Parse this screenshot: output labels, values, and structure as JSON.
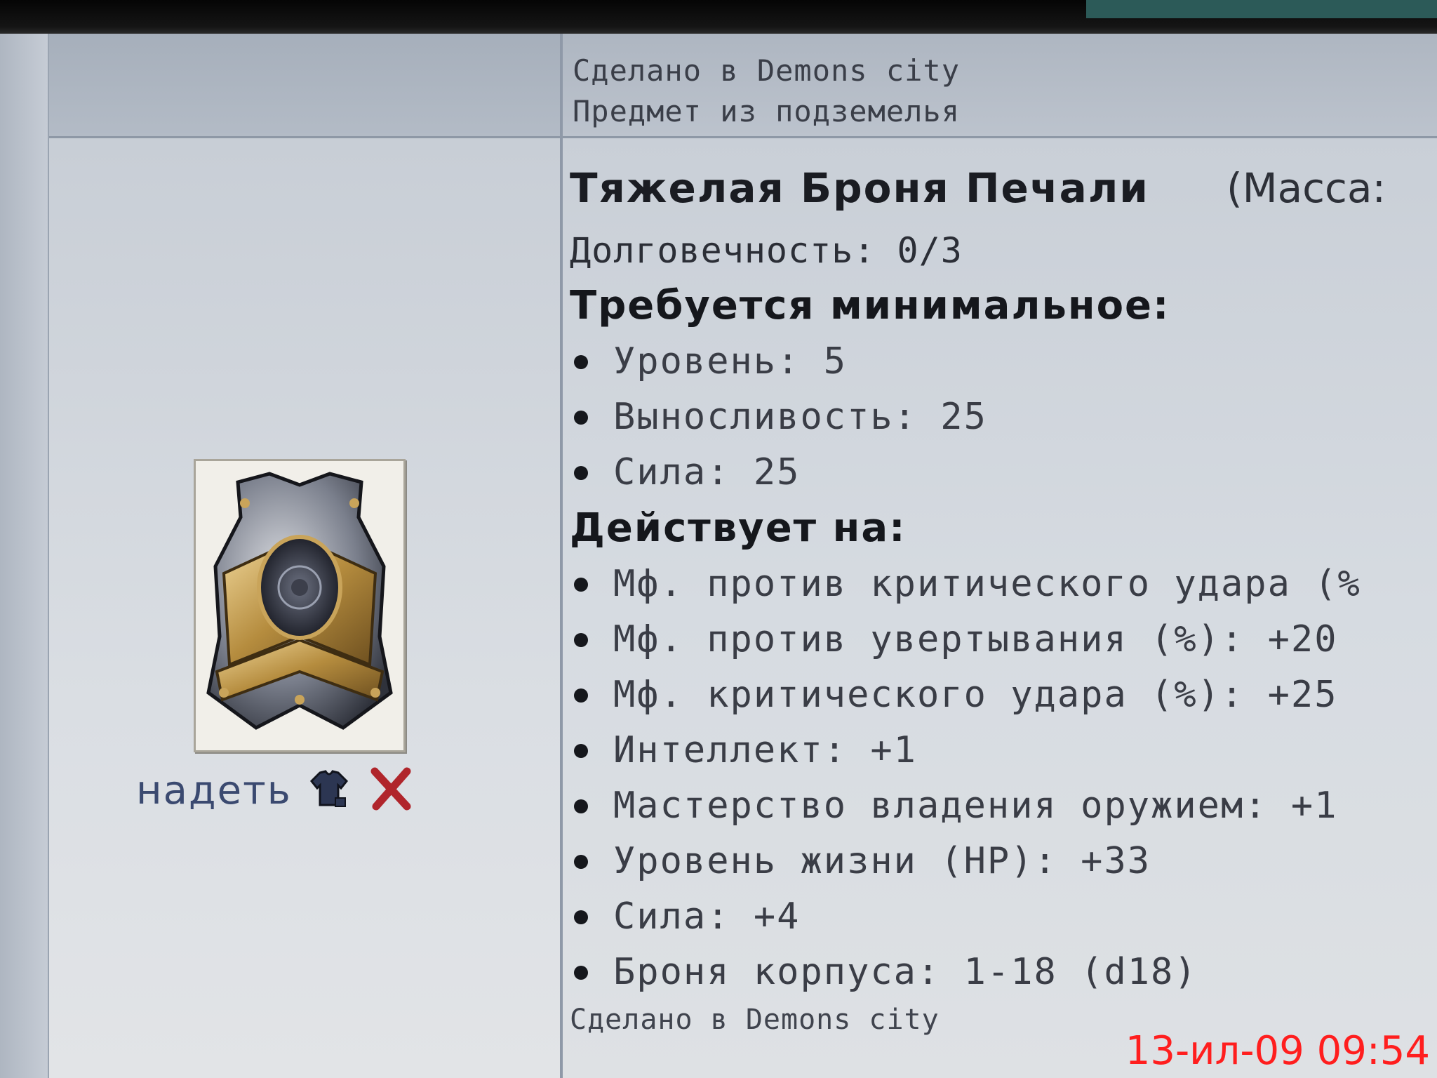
{
  "header": {
    "lines": [
      "Сделано в Demons city",
      "Предмет из подземелья"
    ]
  },
  "item": {
    "title": "Тяжелая Броня Печали",
    "mass_label": "(Масса:",
    "durability": "Долговечность: 0/3",
    "requirements_title": "Требуется минимальное:",
    "requirements": [
      "Уровень: 5",
      "Выносливость: 25",
      "Сила: 25"
    ],
    "effects_title": "Действует на:",
    "effects": [
      "Мф. против критического удара (%",
      "Мф. против увертывания (%): +20",
      "Мф. критического удара (%): +25",
      "Интеллект: +1",
      "Мастерство владения оружием: +1",
      "Уровень жизни (HP): +33",
      "Сила: +4",
      "Броня корпуса: 1-18 (d18)"
    ],
    "footer": "Сделано в Demons city",
    "image_icon": "armor-breastplate-icon"
  },
  "actions": {
    "put_on_label": "надеть",
    "put_on_icon": "shirt-icon",
    "remove_icon": "close-icon"
  },
  "camera_timestamp": "13-ил-09 09:54",
  "colors": {
    "timestamp": "#ff1e1e",
    "remove": "#b0252b",
    "link": "#3b4a70"
  }
}
